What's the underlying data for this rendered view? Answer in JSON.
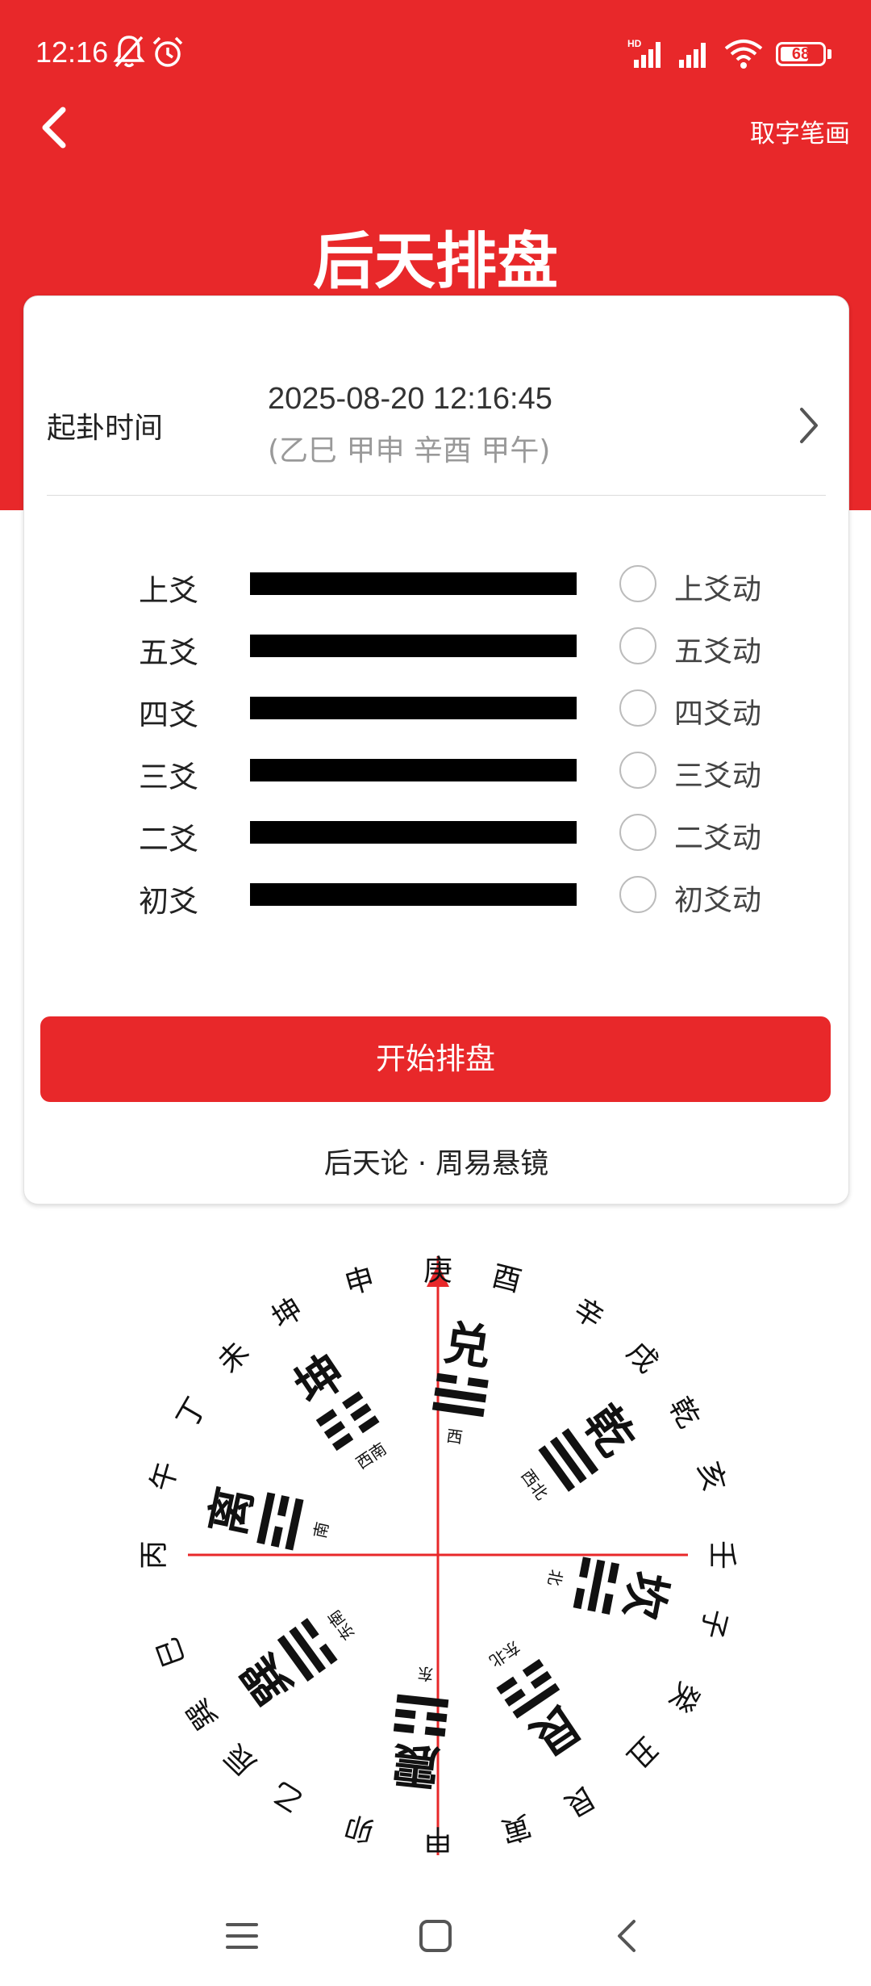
{
  "status_bar": {
    "time": "12:16",
    "battery": "68",
    "battery_level": 0.68,
    "icons": [
      "bell-off-icon",
      "alarm-icon",
      "hd-signal-icon",
      "signal-icon",
      "wifi-icon",
      "battery-icon"
    ]
  },
  "header": {
    "back_icon": "chevron-left-icon",
    "stroke_button": "取字笔画",
    "title": "后天排盘"
  },
  "time_row": {
    "label": "起卦时间",
    "value": "2025-08-20 12:16:45",
    "ganzhi": "(乙巳 甲申 辛酉 甲午)",
    "chevron_icon": "chevron-right-icon"
  },
  "yao_lines": [
    {
      "label": "上爻",
      "type": "yang",
      "move_label": "上爻动",
      "checked": false
    },
    {
      "label": "五爻",
      "type": "yang",
      "move_label": "五爻动",
      "checked": false
    },
    {
      "label": "四爻",
      "type": "yang",
      "move_label": "四爻动",
      "checked": false
    },
    {
      "label": "三爻",
      "type": "yang",
      "move_label": "三爻动",
      "checked": false
    },
    {
      "label": "二爻",
      "type": "yang",
      "move_label": "二爻动",
      "checked": false
    },
    {
      "label": "初爻",
      "type": "yang",
      "move_label": "初爻动",
      "checked": false
    }
  ],
  "start_button": "开始排盘",
  "footer": {
    "credit": "后天论 · 周易悬镜"
  },
  "bagua": {
    "accent_color": "#E8282A",
    "stems_branches": [
      {
        "text": "庚",
        "angle": 0
      },
      {
        "text": "酉",
        "angle": 14
      },
      {
        "text": "辛",
        "angle": 32
      },
      {
        "text": "戌",
        "angle": 46
      },
      {
        "text": "乾",
        "angle": 60
      },
      {
        "text": "亥",
        "angle": 74
      },
      {
        "text": "壬",
        "angle": 90
      },
      {
        "text": "子",
        "angle": 104
      },
      {
        "text": "癸",
        "angle": 120
      },
      {
        "text": "丑",
        "angle": 134
      },
      {
        "text": "艮",
        "angle": 150
      },
      {
        "text": "寅",
        "angle": 164
      },
      {
        "text": "甲",
        "angle": 180
      },
      {
        "text": "卯",
        "angle": 196
      },
      {
        "text": "乙",
        "angle": 212
      },
      {
        "text": "辰",
        "angle": 224
      },
      {
        "text": "巽",
        "angle": 236
      },
      {
        "text": "巳",
        "angle": 250
      },
      {
        "text": "丙",
        "angle": 270
      },
      {
        "text": "午",
        "angle": 286
      },
      {
        "text": "丁",
        "angle": 300
      },
      {
        "text": "未",
        "angle": 314
      },
      {
        "text": "坤",
        "angle": 328
      },
      {
        "text": "申",
        "angle": 344
      }
    ],
    "trigrams": [
      {
        "name": "兑",
        "direction": "西",
        "angle": 8,
        "lines": [
          "broken",
          "solid",
          "solid"
        ]
      },
      {
        "name": "乾",
        "direction": "西北",
        "angle": 54,
        "lines": [
          "solid",
          "solid",
          "solid"
        ]
      },
      {
        "name": "坎",
        "direction": "北",
        "angle": 101,
        "lines": [
          "broken",
          "solid",
          "broken"
        ]
      },
      {
        "name": "艮",
        "direction": "东北",
        "angle": 146,
        "lines": [
          "solid",
          "broken",
          "broken"
        ]
      },
      {
        "name": "震",
        "direction": "东",
        "angle": 186,
        "lines": [
          "broken",
          "broken",
          "solid"
        ]
      },
      {
        "name": "巽",
        "direction": "东南",
        "angle": 234,
        "lines": [
          "solid",
          "solid",
          "broken"
        ]
      },
      {
        "name": "离",
        "direction": "南",
        "angle": 282,
        "lines": [
          "solid",
          "broken",
          "solid"
        ]
      },
      {
        "name": "坤",
        "direction": "西南",
        "angle": 326,
        "lines": [
          "broken",
          "broken",
          "broken"
        ]
      }
    ]
  },
  "nav_bar": {
    "icons": [
      "menu-icon",
      "home-square-icon",
      "back-triangle-icon"
    ]
  }
}
